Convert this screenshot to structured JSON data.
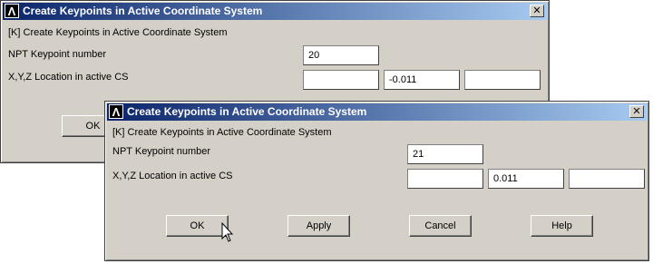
{
  "dialog_back": {
    "title": "Create Keypoints in Active Coordinate System",
    "header_line": "[K]  Create Keypoints in Active Coordinate System",
    "npt_label": "NPT    Keypoint number",
    "npt_value": "20",
    "xyz_label": "X,Y,Z  Location in active CS",
    "x_value": "",
    "y_value": "-0.011",
    "z_value": "",
    "ok_label": "OK"
  },
  "dialog_front": {
    "title": "Create Keypoints in Active Coordinate System",
    "header_line": "[K]  Create Keypoints in Active Coordinate System",
    "npt_label": "NPT    Keypoint number",
    "npt_value": "21",
    "xyz_label": "X,Y,Z  Location in active CS",
    "x_value": "",
    "y_value": "0.011",
    "z_value": "",
    "buttons": {
      "ok": "OK",
      "apply": "Apply",
      "cancel": "Cancel",
      "help": "Help"
    }
  },
  "icons": {
    "app_icon_glyph": "Λ",
    "close_glyph": "✕"
  },
  "colors": {
    "titlebar_start": "#0a246a",
    "titlebar_end": "#a6caf0",
    "dialog_bg": "#d4d0c8"
  }
}
